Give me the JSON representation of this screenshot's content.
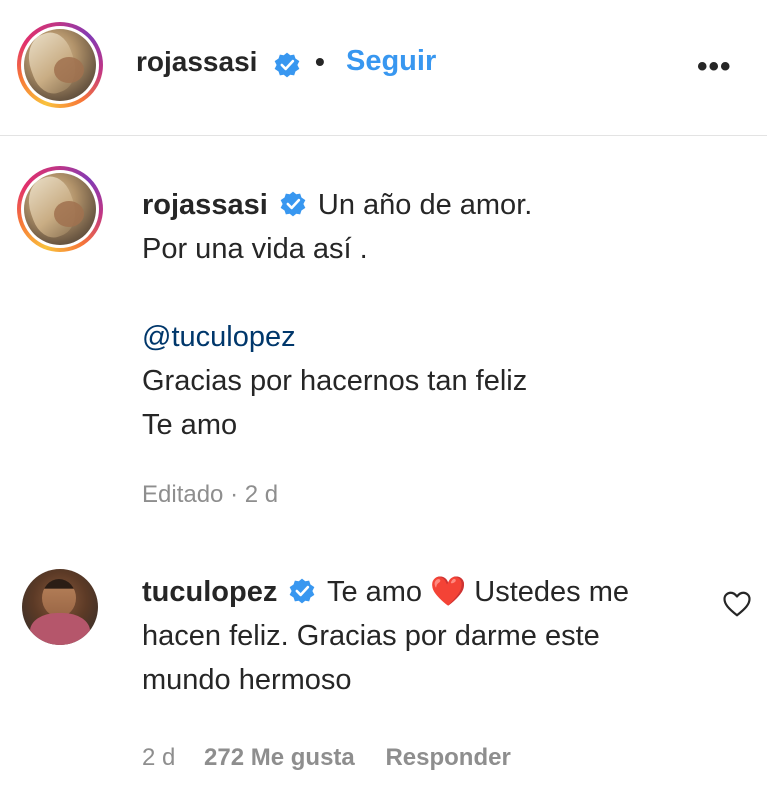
{
  "header": {
    "username": "rojassasi",
    "separator": "•",
    "follow_label": "Seguir",
    "more_label": "•••"
  },
  "caption": {
    "username": "rojassasi",
    "line1": "Un año de amor.",
    "line2": "Por una vida así .",
    "mention": "@tuculopez",
    "line3": "Gracias por hacernos tan feliz",
    "line4": "Te amo",
    "meta": "Editado · 2 d"
  },
  "comment": {
    "username": "tuculopez",
    "text_before_heart": "Te amo",
    "heart": "❤️",
    "text_after_heart": "Ustedes me hacen feliz. Gracias por darme este mundo hermoso",
    "time": "2 d",
    "likes": "272 Me gusta",
    "reply_label": "Responder"
  },
  "colors": {
    "accent": "#3897f0",
    "mention": "#00376b",
    "meta": "#8e8e8e",
    "heart": "#ed4956"
  }
}
